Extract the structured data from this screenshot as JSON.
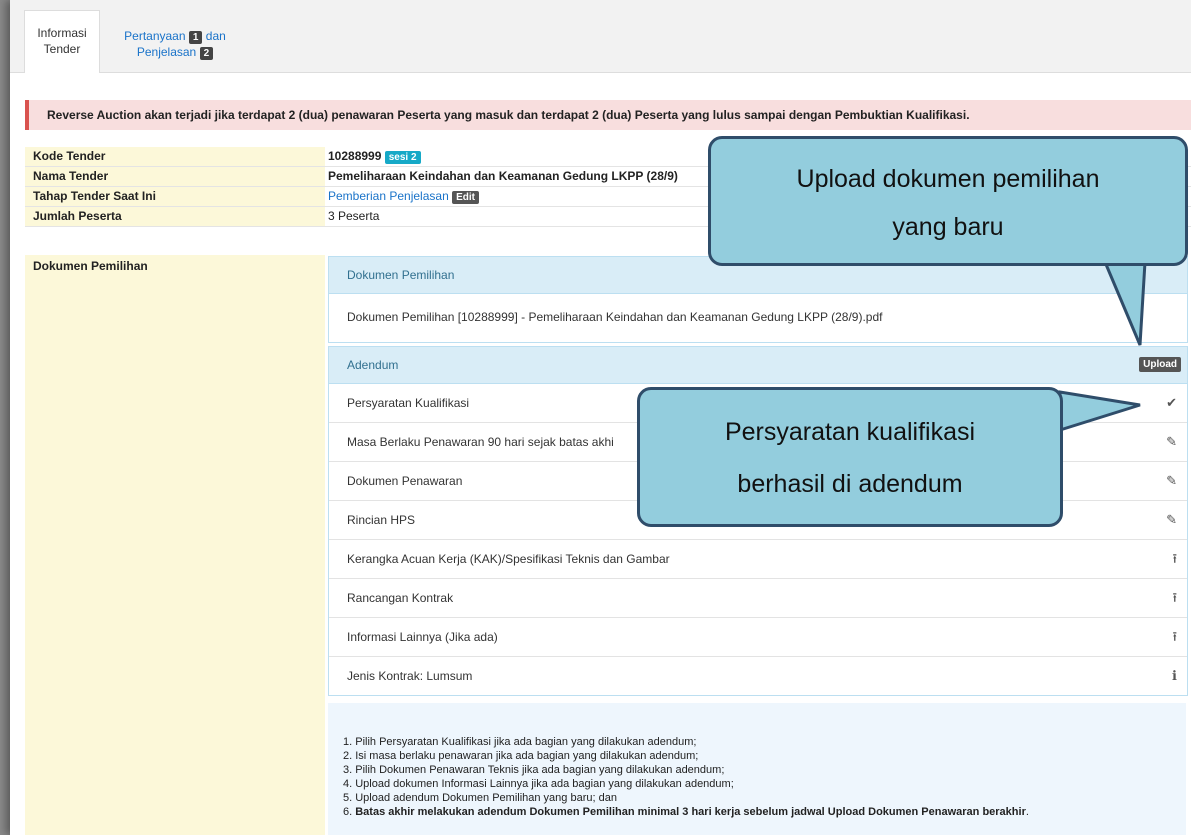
{
  "tabs": {
    "active": {
      "line1": "Informasi",
      "line2": "Tender"
    },
    "link": {
      "part1": "Pertanyaan",
      "badge1": "1",
      "part2": "dan",
      "part3": "Penjelasan",
      "badge2": "2"
    }
  },
  "alert": "Reverse Auction akan terjadi jika terdapat 2 (dua) penawaran Peserta yang masuk dan terdapat 2 (dua) Peserta yang lulus sampai dengan Pembuktian Kualifikasi.",
  "fields": {
    "kode_label": "Kode Tender",
    "kode_value": "10288999",
    "sesi": "sesi 2",
    "nama_label": "Nama Tender",
    "nama_value": "Pemeliharaan Keindahan dan Keamanan Gedung LKPP (28/9)",
    "tahap_label": "Tahap Tender Saat Ini",
    "tahap_value": "Pemberian Penjelasan",
    "tahap_edit": "Edit",
    "jumlah_label": "Jumlah Peserta",
    "jumlah_value": "3 Peserta",
    "dokumen_label": "Dokumen Pemilihan"
  },
  "dokumen_panel": {
    "title": "Dokumen Pemilihan",
    "file": "Dokumen Pemilihan [10288999] - Pemeliharaan Keindahan dan Keamanan Gedung LKPP (28/9).pdf"
  },
  "adendum_panel": {
    "title": "Adendum",
    "upload": "Upload",
    "items": [
      {
        "label": "Persyaratan Kualifikasi",
        "icon": "✔",
        "icon_name": "check-icon"
      },
      {
        "label": "Masa Berlaku Penawaran 90 hari sejak batas akhi",
        "icon": "✎",
        "icon_name": "edit-icon"
      },
      {
        "label": "Dokumen Penawaran",
        "icon": "✎",
        "icon_name": "edit-icon"
      },
      {
        "label": "Rincian HPS",
        "icon": "✎",
        "icon_name": "edit-icon"
      },
      {
        "label": "Kerangka Acuan Kerja (KAK)/Spesifikasi Teknis dan Gambar",
        "icon": "⭱",
        "icon_name": "upload-icon"
      },
      {
        "label": "Rancangan Kontrak",
        "icon": "⭱",
        "icon_name": "upload-icon"
      },
      {
        "label": "Informasi Lainnya (Jika ada)",
        "icon": "⭱",
        "icon_name": "upload-icon"
      },
      {
        "label": "Jenis Kontrak: Lumsum",
        "icon": "ℹ",
        "icon_name": "info-icon"
      }
    ]
  },
  "notes": [
    "1. Pilih Persyaratan Kualifikasi jika ada bagian yang dilakukan adendum;",
    "2. Isi masa berlaku penawaran jika ada bagian yang dilakukan adendum;",
    "3. Pilih Dokumen Penawaran Teknis jika ada bagian yang dilakukan adendum;",
    "4. Upload dokumen Informasi Lainnya jika ada bagian yang dilakukan adendum;",
    "5. Upload adendum Dokumen Pemilihan yang baru; dan"
  ],
  "note6": {
    "prefix": "6. ",
    "bold": "Batas akhir melakukan adendum Dokumen Pemilihan minimal 3 hari kerja sebelum jadwal Upload Dokumen Penawaran berakhir",
    "suffix": "."
  },
  "callouts": {
    "upload": {
      "line1": "Upload dokumen pemilihan",
      "line2": "yang baru"
    },
    "persyaratan": {
      "line1": "Persyaratan kualifikasi",
      "line2": "berhasil di adendum"
    }
  },
  "colors": {
    "callout_fill": "#93cddd",
    "callout_border": "#2f4d6a",
    "alert_bg": "#f8dede",
    "label_bg": "#fcf8d9"
  }
}
